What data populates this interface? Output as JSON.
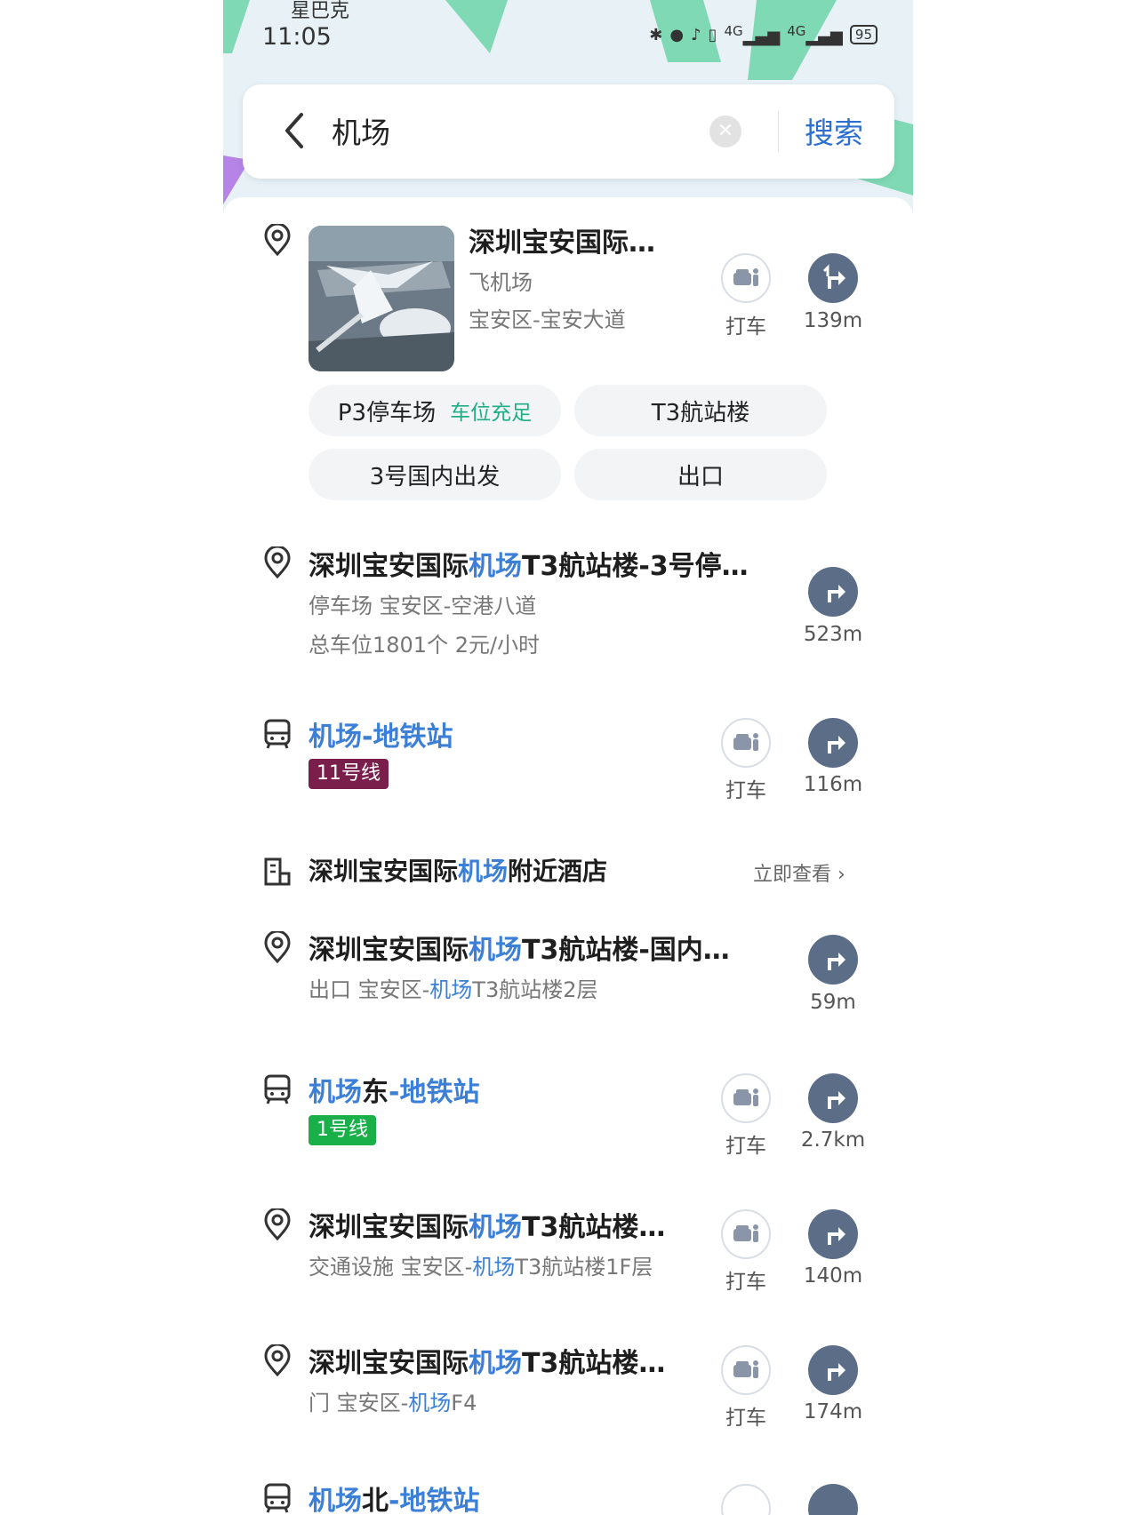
{
  "status": {
    "carrier": "星巴克",
    "time": "11:05",
    "signal1": "4G",
    "signal2": "4G",
    "battery": "95"
  },
  "search": {
    "query": "机场",
    "search_label": "搜索"
  },
  "colors": {
    "accent": "#3c7fd7",
    "line11": "#7a1f4b",
    "line1": "#19b04a",
    "available": "#1fae86"
  },
  "featured": {
    "title": "深圳宝安国际…",
    "category": "飞机场",
    "address": "宝安区-宝安大道",
    "taxi_label": "打车",
    "distance": "139m",
    "chips": [
      {
        "label": "P3停车场",
        "status": "车位充足"
      },
      {
        "label": "T3航站楼"
      },
      {
        "label": "3号国内出发"
      },
      {
        "label": "出口"
      }
    ]
  },
  "results": [
    {
      "title_pre": "深圳宝安国际",
      "title_hl": "机场",
      "title_post": "T3航站楼-3号停…",
      "line1": "停车场   宝安区-空港八道",
      "line2": "总车位1801个   2元/小时",
      "distance": "523m"
    },
    {
      "title_hl": "机场-地铁站",
      "badge": "11号线",
      "taxi_label": "打车",
      "distance": "116m"
    },
    {
      "hotel_pre": "深圳宝安国际",
      "hotel_hl": "机场",
      "hotel_post": "附近酒店",
      "link": "立即查看"
    },
    {
      "title_pre": "深圳宝安国际",
      "title_hl": "机场",
      "title_post": "T3航站楼-国内…",
      "line1_pre": "出口   宝安区-",
      "line1_hl": "机场",
      "line1_post": "T3航站楼2层",
      "distance": "59m"
    },
    {
      "title_hl": "机场",
      "title_mid": "东",
      "title_hl2": "-地铁站",
      "badge": "1号线",
      "taxi_label": "打车",
      "distance": "2.7km"
    },
    {
      "title_pre": "深圳宝安国际",
      "title_hl": "机场",
      "title_post": "T3航站楼…",
      "line1_pre": "交通设施   宝安区-",
      "line1_hl": "机场",
      "line1_post": "T3航站楼1F层",
      "taxi_label": "打车",
      "distance": "140m"
    },
    {
      "title_pre": "深圳宝安国际",
      "title_hl": "机场",
      "title_post": "T3航站楼…",
      "line1_pre": "门   宝安区-",
      "line1_hl": "机场",
      "line1_post": "F4",
      "taxi_label": "打车",
      "distance": "174m"
    },
    {
      "title_hl": "机场",
      "title_mid": "北",
      "title_hl2": "-地铁站"
    }
  ]
}
